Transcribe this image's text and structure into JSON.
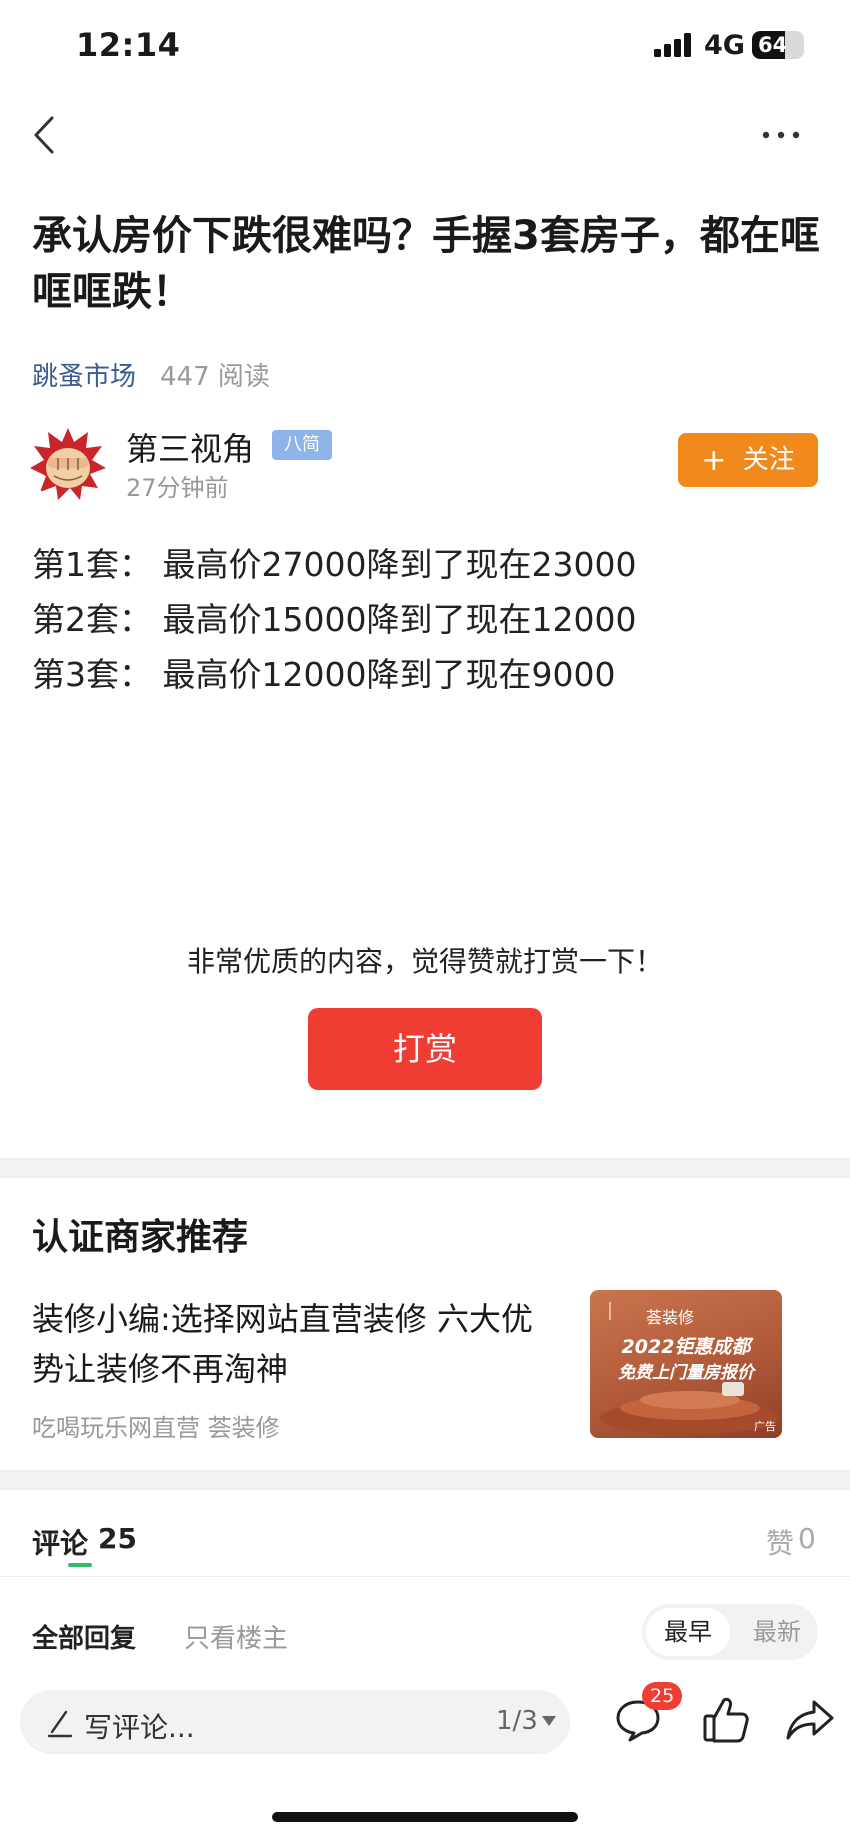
{
  "status_bar": {
    "time": "12:14",
    "network": "4G",
    "battery": "64",
    "battery_level": 0.64
  },
  "article": {
    "title": "承认房价下跌很难吗？手握3套房子，都在哐哐哐跌！",
    "source": "跳蚤市场",
    "reads": "447 阅读",
    "author": {
      "name": "第三视角",
      "badge": "八简",
      "time": "27分钟前",
      "follow_label": "关注"
    },
    "lines": [
      "第1套：  最高价27000降到了现在23000",
      "第2套：  最高价15000降到了现在12000",
      "第3套：  最高价12000降到了现在9000"
    ]
  },
  "tip": {
    "text": "非常优质的内容，觉得赞就打赏一下！",
    "button": "打赏"
  },
  "recommend": {
    "title": "认证商家推荐",
    "item_title": "装修小编:选择网站直营装修 六大优势让装修不再淘神",
    "item_meta": "吃喝玩乐网直营 荟装修",
    "thumb": {
      "logo": "荟装修",
      "line1": "2022钜惠成都",
      "line2": "免费上门量房报价",
      "ad": "广告"
    }
  },
  "comments": {
    "label": "评论",
    "count": "25",
    "like_label": "赞",
    "like_count": "0",
    "filter_all": "全部回复",
    "filter_op": "只看楼主",
    "sort_early": "最早",
    "sort_new": "最新"
  },
  "bottom_bar": {
    "placeholder": "写评论...",
    "page": "1/3",
    "comment_badge": "25",
    "icons": [
      "pen-icon",
      "comment-icon",
      "thumbs-up-icon",
      "share-icon"
    ]
  }
}
